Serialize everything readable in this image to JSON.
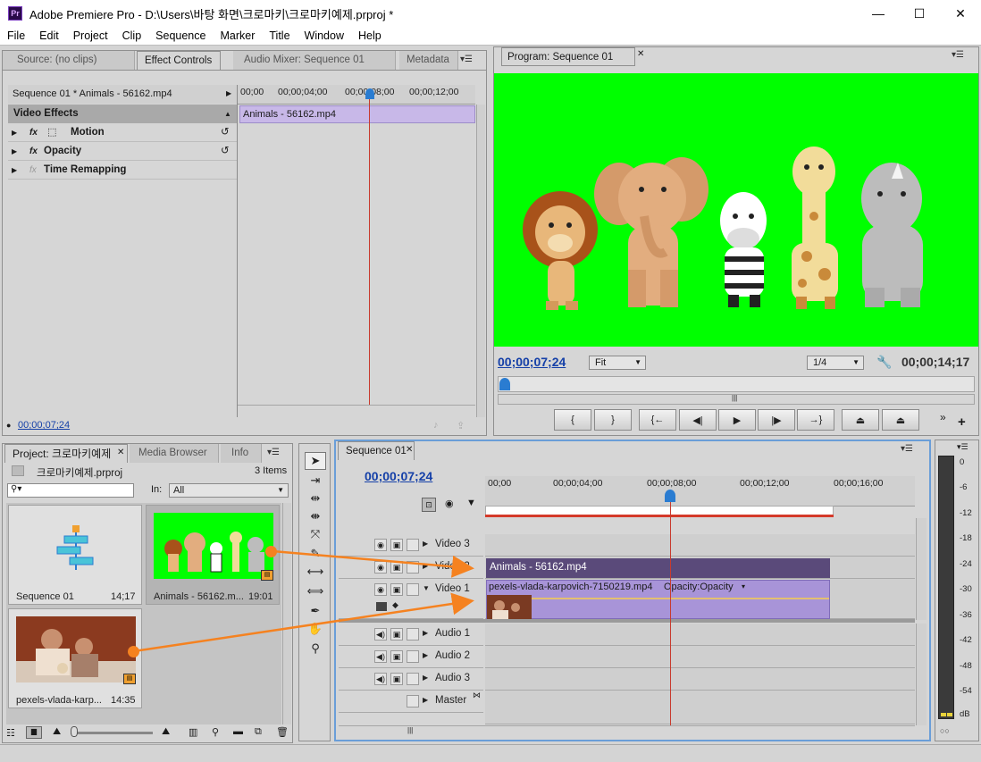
{
  "window": {
    "title": "Adobe Premiere Pro - D:\\Users\\바탕 화면\\크로마키\\크로마키예제.prproj *",
    "app_icon": "Pr",
    "controls": [
      "—",
      "☐",
      "✕"
    ]
  },
  "menu": [
    "File",
    "Edit",
    "Project",
    "Clip",
    "Sequence",
    "Marker",
    "Title",
    "Window",
    "Help"
  ],
  "source_panel": {
    "tabs": [
      "Source: (no clips)",
      "Effect Controls",
      "Audio Mixer: Sequence 01",
      "Metadata"
    ],
    "active_tab": "Effect Controls",
    "clip_header": "Sequence 01 * Animals - 56162.mp4",
    "section": "Video Effects",
    "effects": [
      "Motion",
      "Opacity",
      "Time Remapping"
    ],
    "fx_label": "fx",
    "ruler": [
      "00;00",
      "00;00;04;00",
      "00;00;08;00",
      "00;00;12;00"
    ],
    "clip_bar": "Animals - 56162.mp4",
    "timecode": "00;00;07;24"
  },
  "program_panel": {
    "tab": "Program: Sequence 01",
    "current_timecode": "00;00;07;24",
    "zoom": "Fit",
    "resolution": "1/4",
    "duration": "00;00;14;17",
    "background_color": "#00ff00"
  },
  "project_panel": {
    "tabs": [
      "Project: 크로마키예제",
      "Media Browser",
      "Info"
    ],
    "project_file": "크로마키예제.prproj",
    "item_count": "3 Items",
    "search_placeholder": "",
    "in_label": "In:",
    "in_value": "All",
    "items": [
      {
        "name": "Sequence 01",
        "duration": "14;17"
      },
      {
        "name": "Animals - 56162.m...",
        "duration": "19:01"
      },
      {
        "name": "pexels-vlada-karp...",
        "duration": "14:35"
      }
    ]
  },
  "timeline": {
    "tab": "Sequence 01",
    "timecode": "00;00;07;24",
    "ruler": [
      "00;00",
      "00;00;04;00",
      "00;00;08;00",
      "00;00;12;00",
      "00;00;16;00"
    ],
    "video_tracks": [
      "Video 3",
      "Video 2",
      "Video 1"
    ],
    "audio_tracks": [
      "Audio 1",
      "Audio 2",
      "Audio 3",
      "Master"
    ],
    "clip_v2": "Animals - 56162.mp4",
    "clip_v1": "pexels-vlada-karpovich-7150219.mp4",
    "clip_v1_fx": "Opacity:Opacity",
    "clip_v2_color": "#5a4a7a",
    "clip_v1_color": "#a894d8"
  },
  "audio_meter": {
    "labels": [
      "0",
      "-6",
      "-12",
      "-18",
      "-24",
      "-30",
      "-36",
      "-42",
      "-48",
      "-54",
      "dB"
    ]
  },
  "colors": {
    "accent_orange": "#f58220",
    "playhead_red": "#c83b2e",
    "timecode_blue": "#1540a8"
  }
}
